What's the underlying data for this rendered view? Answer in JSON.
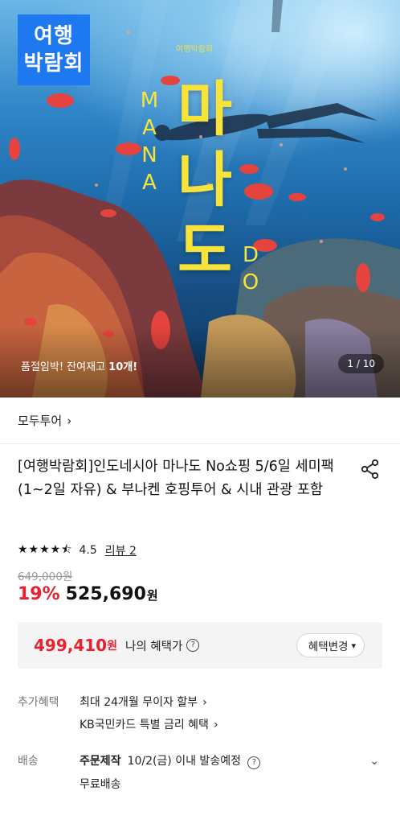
{
  "hero": {
    "badge_line1": "여행",
    "badge_line2": "박람회",
    "small_logo": "여행박람회",
    "title_chars": [
      "마",
      "나",
      "도"
    ],
    "mana_chars": [
      "M",
      "A",
      "N",
      "A"
    ],
    "do_chars": [
      "D",
      "O"
    ],
    "stock_prefix": "품절임박! 잔여재고 ",
    "stock_count": "10개!",
    "page_counter": "1 / 10"
  },
  "brand": {
    "name": "모두투어",
    "chevron": "›"
  },
  "product": {
    "title": "[여행박람회]인도네시아 마나도 No쇼핑 5/6일 세미팩 (1~2일 자유) & 부나켄 호핑투어 & 시내 관광 포함",
    "stars": "★★★★⯪",
    "rating": "4.5",
    "review_label": "리뷰 2",
    "original_price": "649,000원",
    "discount": "19%",
    "price": "525,690",
    "currency": "원"
  },
  "benefit": {
    "price": "499,410",
    "currency": "원",
    "label": "나의 혜택가",
    "change_button": "혜택변경"
  },
  "extra": {
    "label": "추가혜택",
    "line1": "최대 24개월 무이자 할부",
    "line2": "KB국민카드 특별 금리 혜택"
  },
  "shipping": {
    "label": "배송",
    "type": "주문제작",
    "schedule": "10/2(금) 이내 발송예정",
    "fee": "무료배송"
  },
  "colors": {
    "accent_red": "#e8212e",
    "badge_blue": "#1e78f0",
    "title_yellow": "#f7e33a"
  }
}
